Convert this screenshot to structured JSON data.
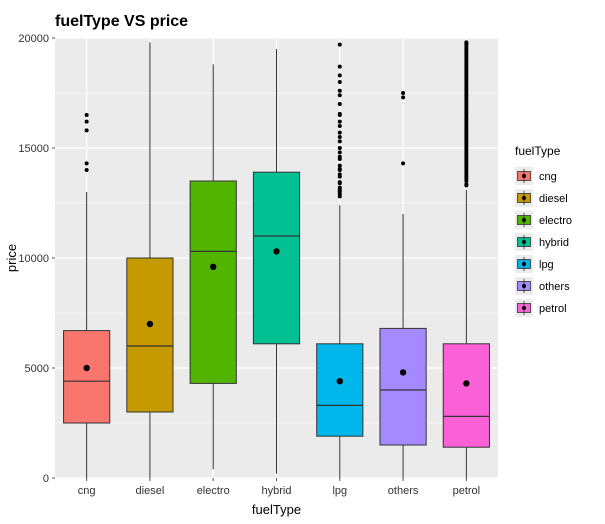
{
  "chart_data": {
    "type": "box",
    "title": "fuelType VS price",
    "xlabel": "fuelType",
    "ylabel": "price",
    "ylim": [
      0,
      20000
    ],
    "yticks": [
      0,
      5000,
      10000,
      15000,
      20000
    ],
    "categories": [
      "cng",
      "diesel",
      "electro",
      "hybrid",
      "lpg",
      "others",
      "petrol"
    ],
    "series": [
      {
        "name": "cng",
        "color": "#F8766D",
        "lower_whisker": 0,
        "q1": 2500,
        "median": 4400,
        "q3": 6700,
        "upper_whisker": 13000,
        "mean": 5000,
        "outliers": [
          14000,
          14300,
          15800,
          16200,
          16500
        ]
      },
      {
        "name": "diesel",
        "color": "#C49A00",
        "lower_whisker": 0,
        "q1": 3000,
        "median": 6000,
        "q3": 10000,
        "upper_whisker": 19800,
        "mean": 7000,
        "outliers": []
      },
      {
        "name": "electro",
        "color": "#53B400",
        "lower_whisker": 400,
        "q1": 4300,
        "median": 10300,
        "q3": 13500,
        "upper_whisker": 18800,
        "mean": 9600,
        "outliers": []
      },
      {
        "name": "hybrid",
        "color": "#00C094",
        "lower_whisker": 200,
        "q1": 6100,
        "median": 11000,
        "q3": 13900,
        "upper_whisker": 19500,
        "mean": 10300,
        "outliers": []
      },
      {
        "name": "lpg",
        "color": "#00B6EB",
        "lower_whisker": 0,
        "q1": 1900,
        "median": 3300,
        "q3": 6100,
        "upper_whisker": 12400,
        "mean": 4400,
        "outliers": [
          12800,
          12900,
          13000,
          13050,
          13100,
          13200,
          13400,
          13450,
          13700,
          13800,
          14000,
          14050,
          14200,
          14500,
          14600,
          14800,
          15000,
          15300,
          15500,
          15700,
          16000,
          16200,
          16500,
          16550,
          17000,
          17400,
          17600,
          18000,
          18300,
          18700,
          19700
        ]
      },
      {
        "name": "others",
        "color": "#A58AFF",
        "lower_whisker": 0,
        "q1": 1500,
        "median": 4000,
        "q3": 6800,
        "upper_whisker": 12000,
        "mean": 4800,
        "outliers": [
          14300,
          17300,
          17500
        ]
      },
      {
        "name": "petrol",
        "color": "#FB61D7",
        "lower_whisker": 0,
        "q1": 1400,
        "median": 2800,
        "q3": 6100,
        "upper_whisker": 13100,
        "mean": 4300,
        "outliers": [
          13300,
          13350,
          13500,
          13600,
          13700,
          13800,
          13900,
          14000,
          14100,
          14200,
          14300,
          14400,
          14500,
          14600,
          14700,
          14800,
          14900,
          15000,
          15100,
          15200,
          15300,
          15400,
          15500,
          15600,
          15700,
          15800,
          15900,
          16000,
          16100,
          16200,
          16300,
          16400,
          16500,
          16600,
          16700,
          16800,
          16900,
          17000,
          17100,
          17200,
          17300,
          17400,
          17500,
          17600,
          17700,
          17800,
          17900,
          18000,
          18100,
          18200,
          18300,
          18400,
          18500,
          18600,
          18700,
          18800,
          18900,
          19000,
          19100,
          19200,
          19300,
          19400,
          19500,
          19600,
          19700,
          19750,
          19800
        ]
      }
    ],
    "legend": {
      "title": "fuelType",
      "entries": [
        {
          "label": "cng",
          "color": "#F8766D"
        },
        {
          "label": "diesel",
          "color": "#C49A00"
        },
        {
          "label": "electro",
          "color": "#53B400"
        },
        {
          "label": "hybrid",
          "color": "#00C094"
        },
        {
          "label": "lpg",
          "color": "#00B6EB"
        },
        {
          "label": "others",
          "color": "#A58AFF"
        },
        {
          "label": "petrol",
          "color": "#FB61D7"
        }
      ]
    }
  }
}
